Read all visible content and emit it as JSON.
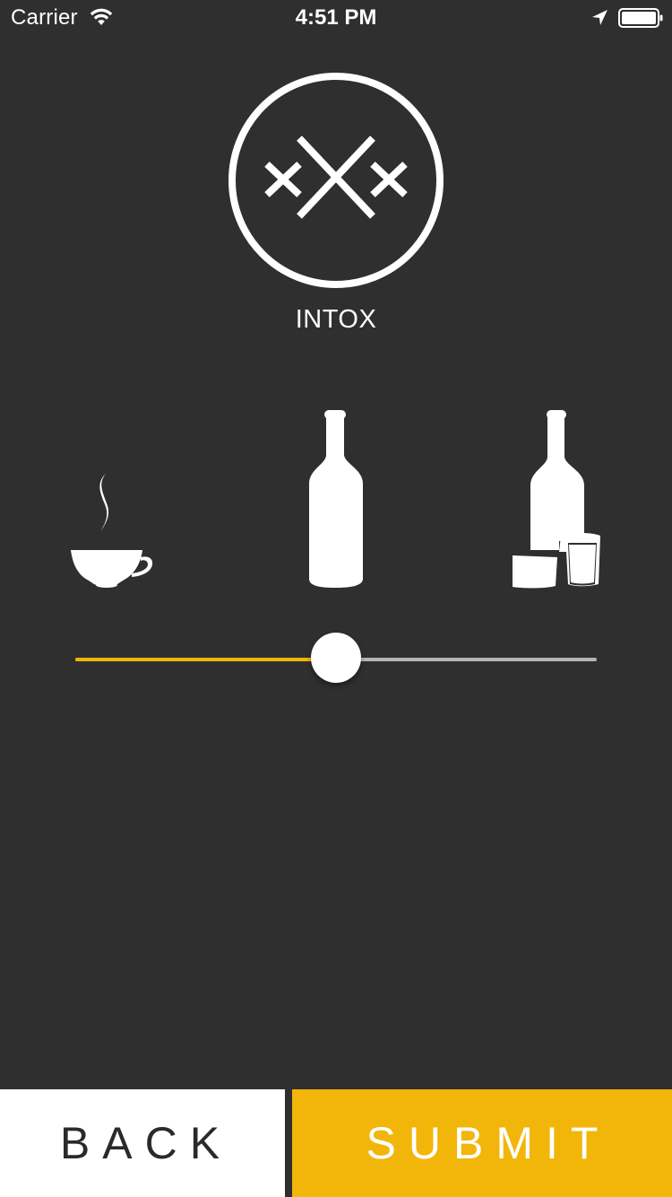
{
  "status_bar": {
    "carrier": "Carrier",
    "time": "4:51 PM",
    "icons": [
      "wifi-icon",
      "location-arrow-icon",
      "battery-icon"
    ]
  },
  "logo": {
    "icon": "intox-logo-icon"
  },
  "app_title": "INTOX",
  "drink_levels": [
    "coffee-cup-icon",
    "bottle-icon",
    "bottle-with-glasses-icon"
  ],
  "slider": {
    "value": 0.5,
    "min": 0,
    "max": 1
  },
  "buttons": {
    "back_label": "BACK",
    "submit_label": "SUBMIT"
  },
  "colors": {
    "background": "#2f2f2f",
    "accent": "#f2b509",
    "track": "#b5b5b5",
    "white": "#ffffff"
  }
}
